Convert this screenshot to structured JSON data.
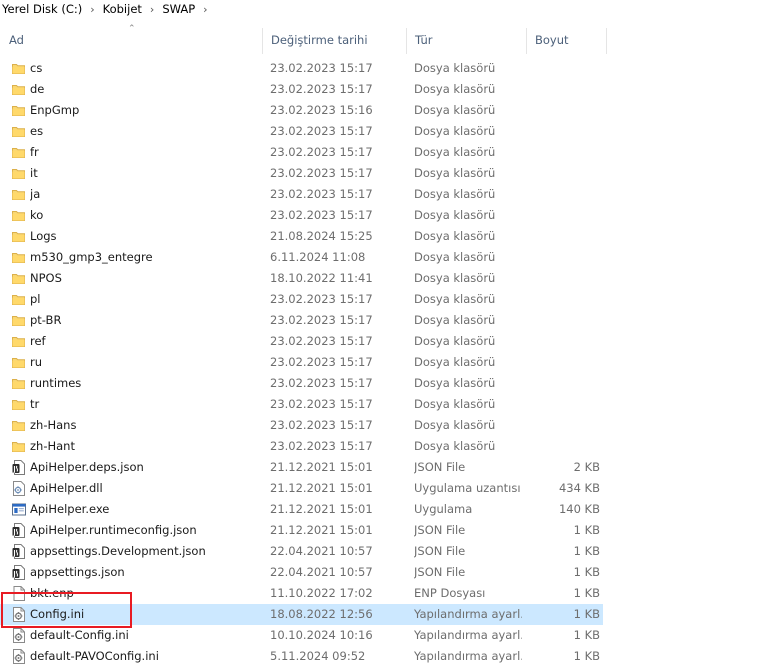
{
  "breadcrumb": [
    "Yerel Disk (C:)",
    "Kobijet",
    "SWAP"
  ],
  "columns": {
    "name": "Ad",
    "date": "Değiştirme tarihi",
    "type": "Tür",
    "size": "Boyut"
  },
  "rows": [
    {
      "name": "cs",
      "date": "23.02.2023 15:17",
      "type": "Dosya klasörü",
      "size": "",
      "icon": "folder-icon"
    },
    {
      "name": "de",
      "date": "23.02.2023 15:17",
      "type": "Dosya klasörü",
      "size": "",
      "icon": "folder-icon"
    },
    {
      "name": "EnpGmp",
      "date": "23.02.2023 15:16",
      "type": "Dosya klasörü",
      "size": "",
      "icon": "folder-icon"
    },
    {
      "name": "es",
      "date": "23.02.2023 15:17",
      "type": "Dosya klasörü",
      "size": "",
      "icon": "folder-icon"
    },
    {
      "name": "fr",
      "date": "23.02.2023 15:17",
      "type": "Dosya klasörü",
      "size": "",
      "icon": "folder-icon"
    },
    {
      "name": "it",
      "date": "23.02.2023 15:17",
      "type": "Dosya klasörü",
      "size": "",
      "icon": "folder-icon"
    },
    {
      "name": "ja",
      "date": "23.02.2023 15:17",
      "type": "Dosya klasörü",
      "size": "",
      "icon": "folder-icon"
    },
    {
      "name": "ko",
      "date": "23.02.2023 15:17",
      "type": "Dosya klasörü",
      "size": "",
      "icon": "folder-icon"
    },
    {
      "name": "Logs",
      "date": "21.08.2024 15:25",
      "type": "Dosya klasörü",
      "size": "",
      "icon": "folder-icon"
    },
    {
      "name": "m530_gmp3_entegre",
      "date": "6.11.2024 11:08",
      "type": "Dosya klasörü",
      "size": "",
      "icon": "folder-icon"
    },
    {
      "name": "NPOS",
      "date": "18.10.2022 11:41",
      "type": "Dosya klasörü",
      "size": "",
      "icon": "folder-icon"
    },
    {
      "name": "pl",
      "date": "23.02.2023 15:17",
      "type": "Dosya klasörü",
      "size": "",
      "icon": "folder-icon"
    },
    {
      "name": "pt-BR",
      "date": "23.02.2023 15:17",
      "type": "Dosya klasörü",
      "size": "",
      "icon": "folder-icon"
    },
    {
      "name": "ref",
      "date": "23.02.2023 15:17",
      "type": "Dosya klasörü",
      "size": "",
      "icon": "folder-icon"
    },
    {
      "name": "ru",
      "date": "23.02.2023 15:17",
      "type": "Dosya klasörü",
      "size": "",
      "icon": "folder-icon"
    },
    {
      "name": "runtimes",
      "date": "23.02.2023 15:17",
      "type": "Dosya klasörü",
      "size": "",
      "icon": "folder-icon"
    },
    {
      "name": "tr",
      "date": "23.02.2023 15:17",
      "type": "Dosya klasörü",
      "size": "",
      "icon": "folder-icon"
    },
    {
      "name": "zh-Hans",
      "date": "23.02.2023 15:17",
      "type": "Dosya klasörü",
      "size": "",
      "icon": "folder-icon"
    },
    {
      "name": "zh-Hant",
      "date": "23.02.2023 15:17",
      "type": "Dosya klasörü",
      "size": "",
      "icon": "folder-icon"
    },
    {
      "name": "ApiHelper.deps.json",
      "date": "21.12.2021 15:01",
      "type": "JSON File",
      "size": "2 KB",
      "icon": "json-file-icon"
    },
    {
      "name": "ApiHelper.dll",
      "date": "21.12.2021 15:01",
      "type": "Uygulama uzantısı",
      "size": "434 KB",
      "icon": "dll-file-icon"
    },
    {
      "name": "ApiHelper.exe",
      "date": "21.12.2021 15:01",
      "type": "Uygulama",
      "size": "140 KB",
      "icon": "exe-file-icon"
    },
    {
      "name": "ApiHelper.runtimeconfig.json",
      "date": "21.12.2021 15:01",
      "type": "JSON File",
      "size": "1 KB",
      "icon": "json-file-icon"
    },
    {
      "name": "appsettings.Development.json",
      "date": "22.04.2021 10:57",
      "type": "JSON File",
      "size": "1 KB",
      "icon": "json-file-icon"
    },
    {
      "name": "appsettings.json",
      "date": "22.04.2021 10:57",
      "type": "JSON File",
      "size": "1 KB",
      "icon": "json-file-icon"
    },
    {
      "name": "bkt.enp",
      "date": "11.10.2022 17:02",
      "type": "ENP Dosyası",
      "size": "1 KB",
      "icon": "blank-file-icon"
    },
    {
      "name": "Config.ini",
      "date": "18.08.2022 12:56",
      "type": "Yapılandırma ayarl...",
      "size": "1 KB",
      "icon": "ini-file-icon",
      "selected": true
    },
    {
      "name": "default-Config.ini",
      "date": "10.10.2024 10:16",
      "type": "Yapılandırma ayarl...",
      "size": "1 KB",
      "icon": "ini-file-icon"
    },
    {
      "name": "default-PAVOConfig.ini",
      "date": "5.11.2024 09:52",
      "type": "Yapılandırma ayarl...",
      "size": "1 KB",
      "icon": "ini-file-icon"
    }
  ],
  "colors": {
    "selection": "#cce8ff",
    "folder": "#f8d775",
    "highlight": "#e81b23",
    "header_text": "#4c607a"
  }
}
